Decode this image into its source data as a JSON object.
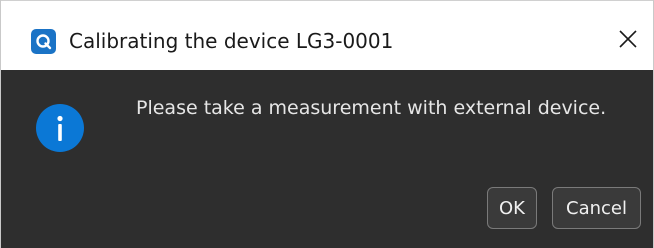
{
  "window": {
    "title": "Calibrating the device LG3-0001",
    "close_icon": "close-icon",
    "app_icon": "app-logo-icon"
  },
  "dialog": {
    "icon": "info-icon",
    "message": "Please take a measurement with external device.",
    "buttons": {
      "ok_label": "OK",
      "cancel_label": "Cancel"
    }
  },
  "colors": {
    "titlebar_bg": "#ffffff",
    "body_bg": "#2e2e2e",
    "accent": "#0b78d6",
    "text_light": "#e6e6e6"
  }
}
